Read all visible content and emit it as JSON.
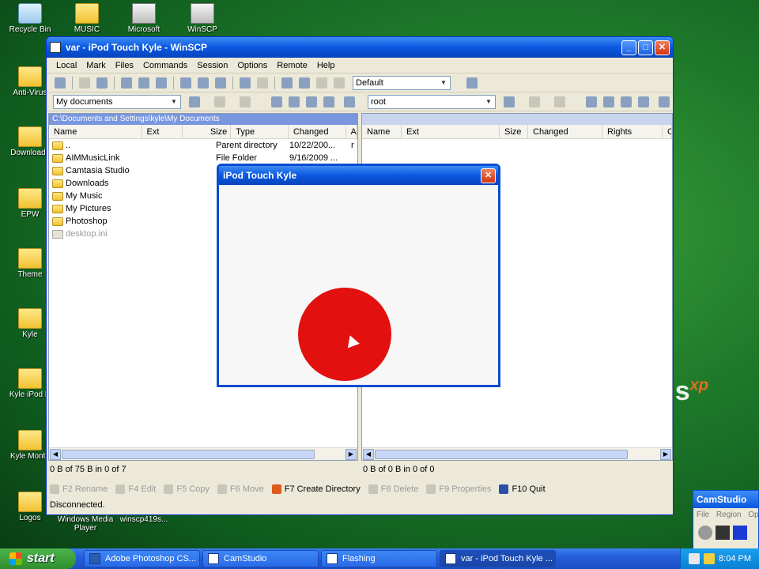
{
  "desktop": {
    "icons": [
      {
        "label": "Recycle Bin",
        "kind": "recycle-icon"
      },
      {
        "label": "MUSIC",
        "kind": "folder-icon"
      },
      {
        "label": "Microsoft",
        "kind": "app-icon"
      },
      {
        "label": "WinSCP",
        "kind": "app-icon"
      },
      {
        "label": "Anti-Virus",
        "kind": "folder-icon"
      },
      {
        "label": "Downloads",
        "kind": "folder-icon"
      },
      {
        "label": "EPW",
        "kind": "folder-icon"
      },
      {
        "label": "Theme",
        "kind": "folder-icon"
      },
      {
        "label": "Kyle",
        "kind": "folder-icon"
      },
      {
        "label": "Kyle iPod H",
        "kind": "folder-icon"
      },
      {
        "label": "Kyle Monta",
        "kind": "folder-icon"
      },
      {
        "label": "Logos",
        "kind": "folder-icon"
      },
      {
        "label": "Windows Media Player",
        "kind": "app-icon"
      },
      {
        "label": "winscp419s...",
        "kind": "app-icon"
      }
    ],
    "xp_text": "s",
    "xp_sup": "xp"
  },
  "window": {
    "title": "var - iPod Touch Kyle - WinSCP",
    "controls": {
      "minimize": "_",
      "maximize": "□",
      "close": "✕"
    },
    "menu": [
      "Local",
      "Mark",
      "Files",
      "Commands",
      "Session",
      "Options",
      "Remote",
      "Help"
    ],
    "transfer_setting": "Default",
    "left_address": "My documents",
    "right_address": "root",
    "left_path": "C:\\Documents and Settings\\kyle\\My Documents",
    "left_columns": [
      "Name",
      "Ext",
      "Size",
      "Type",
      "Changed",
      "A"
    ],
    "right_columns": [
      "Name",
      "Ext",
      "Size",
      "Changed",
      "Rights",
      "C"
    ],
    "left_files": [
      {
        "name": "..",
        "type": "Parent directory",
        "changed": "10/22/200...",
        "attr": "r",
        "icon": "parent-folder-icon",
        "grey": false
      },
      {
        "name": "AIMMusicLink",
        "type": "File Folder",
        "changed": "9/16/2009 ...",
        "attr": "",
        "icon": "folder-icon",
        "grey": false
      },
      {
        "name": "Camtasia Studio",
        "type": "",
        "changed": "",
        "attr": "",
        "icon": "folder-icon",
        "grey": false
      },
      {
        "name": "Downloads",
        "type": "",
        "changed": "",
        "attr": "",
        "icon": "folder-icon",
        "grey": false
      },
      {
        "name": "My Music",
        "type": "",
        "changed": "",
        "attr": "",
        "icon": "music-folder-icon",
        "grey": false
      },
      {
        "name": "My Pictures",
        "type": "",
        "changed": "",
        "attr": "",
        "icon": "pictures-folder-icon",
        "grey": false
      },
      {
        "name": "Photoshop",
        "type": "",
        "changed": "",
        "attr": "",
        "icon": "folder-icon",
        "grey": false
      },
      {
        "name": "desktop.ini",
        "type": "",
        "changed": "",
        "attr": "",
        "icon": "file-icon",
        "grey": true
      }
    ],
    "left_status": "0 B of 75 B in 0 of 7",
    "right_status": "0 B of 0 B in 0 of 0",
    "fkeys": [
      {
        "label": "F2 Rename",
        "enabled": false
      },
      {
        "label": "F4 Edit",
        "enabled": false
      },
      {
        "label": "F5 Copy",
        "enabled": false
      },
      {
        "label": "F6 Move",
        "enabled": false
      },
      {
        "label": "F7 Create Directory",
        "enabled": true
      },
      {
        "label": "F8 Delete",
        "enabled": false
      },
      {
        "label": "F9 Properties",
        "enabled": false
      },
      {
        "label": "F10 Quit",
        "enabled": true
      }
    ],
    "connection_status": "Disconnected."
  },
  "dialog": {
    "title": "iPod Touch Kyle",
    "close": "✕"
  },
  "camstudio": {
    "title": "CamStudio",
    "menu": [
      "File",
      "Region",
      "Op"
    ]
  },
  "taskbar": {
    "start_label": "start",
    "tasks": [
      {
        "label": "Adobe Photoshop CS...",
        "active": false
      },
      {
        "label": "CamStudio",
        "active": false
      },
      {
        "label": "Flashing",
        "active": false
      },
      {
        "label": "var - iPod Touch Kyle ...",
        "active": true
      }
    ],
    "clock": "8:04 PM"
  },
  "colors": {
    "title_blue": "#0a58e0",
    "path_active": "#7a96df",
    "record_red": "#e31010",
    "start_green": "#2f8f2f"
  }
}
